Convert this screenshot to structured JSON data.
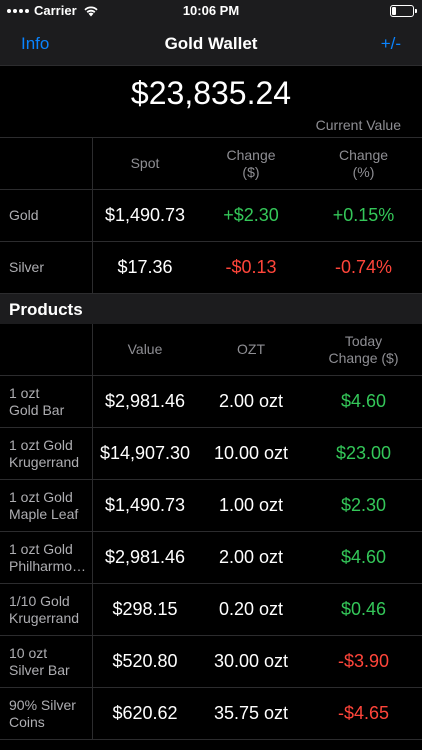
{
  "status": {
    "carrier": "Carrier",
    "time": "10:06 PM",
    "battery_level": 0.2
  },
  "nav": {
    "left": "Info",
    "title": "Gold Wallet",
    "right": "+/-"
  },
  "total": {
    "value": "$23,835.24",
    "label": "Current Value"
  },
  "spot_header": {
    "col1": "Spot",
    "col2_line1": "Change",
    "col2_line2": "($)",
    "col3_line1": "Change",
    "col3_line2": "(%)"
  },
  "metals": [
    {
      "name": "Gold",
      "spot": "$1,490.73",
      "change": "+$2.30",
      "change_pct": "+0.15%"
    },
    {
      "name": "Silver",
      "spot": "$17.36",
      "change": "-$0.13",
      "change_pct": "-0.74%"
    }
  ],
  "section_title": "Products",
  "products_header": {
    "col1": "Value",
    "col2": "OZT",
    "col3_line1": "Today",
    "col3_line2": "Change ($)"
  },
  "products": [
    {
      "name1": "1 ozt",
      "name2": "Gold Bar",
      "value": "$2,981.46",
      "ozt": "2.00 ozt",
      "change": "$4.60"
    },
    {
      "name1": "1 ozt Gold",
      "name2": "Krugerrand",
      "value": "$14,907.30",
      "ozt": "10.00 ozt",
      "change": "$23.00"
    },
    {
      "name1": "1 ozt Gold",
      "name2": "Maple Leaf",
      "value": "$1,490.73",
      "ozt": "1.00 ozt",
      "change": "$2.30"
    },
    {
      "name1": "1 ozt Gold",
      "name2": "Philharmo…",
      "value": "$2,981.46",
      "ozt": "2.00 ozt",
      "change": "$4.60"
    },
    {
      "name1": "1/10 Gold",
      "name2": "Krugerrand",
      "value": "$298.15",
      "ozt": "0.20 ozt",
      "change": "$0.46"
    },
    {
      "name1": "10 ozt",
      "name2": "Silver Bar",
      "value": "$520.80",
      "ozt": "30.00 ozt",
      "change": "-$3.90"
    },
    {
      "name1": "90% Silver",
      "name2": "Coins",
      "value": "$620.62",
      "ozt": "35.75 ozt",
      "change": "-$4.65"
    }
  ],
  "colors": {
    "positive": "#34c759",
    "negative": "#ff453a",
    "accent": "#0a84ff"
  }
}
